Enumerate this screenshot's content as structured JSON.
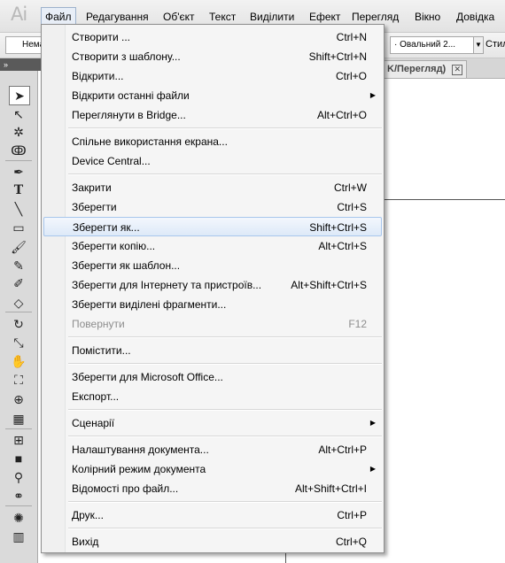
{
  "app": {
    "logo": "Ai"
  },
  "menubar": {
    "items": [
      {
        "label": "Файл"
      },
      {
        "label": "Редагування"
      },
      {
        "label": "Об'єкт"
      },
      {
        "label": "Текст"
      },
      {
        "label": "Виділити"
      },
      {
        "label": "Ефект"
      },
      {
        "label": "Перегляд"
      },
      {
        "label": "Вікно"
      },
      {
        "label": "Довідка"
      }
    ]
  },
  "controlbar": {
    "left_value": "Нема",
    "brush_value": "· Овальний 2...",
    "style_label": "Стил"
  },
  "document": {
    "tab_title": "K/Перегляд)",
    "close_glyph": "✕"
  },
  "toolbox": {
    "icons": [
      "selection-tool",
      "direct-selection-tool",
      "magic-wand-tool",
      "lasso-tool",
      "pen-tool",
      "type-tool",
      "line-tool",
      "rectangle-tool",
      "paintbrush-tool",
      "pencil-tool",
      "blob-brush-tool",
      "eraser-tool",
      "rotate-tool",
      "scale-tool",
      "warp-tool",
      "free-transform-tool",
      "shape-builder-tool",
      "perspective-grid-tool",
      "mesh-tool",
      "gradient-tool",
      "eyedropper-tool",
      "blend-tool",
      "symbol-sprayer-tool",
      "column-graph-tool"
    ]
  },
  "file_menu": {
    "groups": [
      [
        {
          "label": "Створити ...",
          "shortcut": "Ctrl+N"
        },
        {
          "label": "Створити з шаблону...",
          "shortcut": "Shift+Ctrl+N"
        },
        {
          "label": "Відкрити...",
          "shortcut": "Ctrl+O"
        },
        {
          "label": "Відкрити останні файли",
          "shortcut": "",
          "submenu": true
        },
        {
          "label": "Переглянути в Bridge...",
          "shortcut": "Alt+Ctrl+O"
        }
      ],
      [
        {
          "label": "Спільне використання екрана...",
          "shortcut": ""
        },
        {
          "label": "Device Central...",
          "shortcut": ""
        }
      ],
      [
        {
          "label": "Закрити",
          "shortcut": "Ctrl+W"
        },
        {
          "label": "Зберегти",
          "shortcut": "Ctrl+S"
        },
        {
          "label": "Зберегти як...",
          "shortcut": "Shift+Ctrl+S",
          "highlighted": true
        },
        {
          "label": "Зберегти копію...",
          "shortcut": "Alt+Ctrl+S"
        },
        {
          "label": "Зберегти як шаблон...",
          "shortcut": ""
        },
        {
          "label": "Зберегти для Інтернету та пристроїв...",
          "shortcut": "Alt+Shift+Ctrl+S"
        },
        {
          "label": "Зберегти виділені фрагменти...",
          "shortcut": ""
        },
        {
          "label": "Повернути",
          "shortcut": "F12",
          "disabled": true
        }
      ],
      [
        {
          "label": "Помістити...",
          "shortcut": ""
        }
      ],
      [
        {
          "label": "Зберегти для Microsoft Office...",
          "shortcut": ""
        },
        {
          "label": "Експорт...",
          "shortcut": ""
        }
      ],
      [
        {
          "label": "Сценарії",
          "shortcut": "",
          "submenu": true
        }
      ],
      [
        {
          "label": "Налаштування документа...",
          "shortcut": "Alt+Ctrl+P"
        },
        {
          "label": "Колірний режим документа",
          "shortcut": "",
          "submenu": true
        },
        {
          "label": "Відомості про файл...",
          "shortcut": "Alt+Shift+Ctrl+I"
        }
      ],
      [
        {
          "label": "Друк...",
          "shortcut": "Ctrl+P"
        }
      ],
      [
        {
          "label": "Вихід",
          "shortcut": "Ctrl+Q"
        }
      ]
    ]
  }
}
